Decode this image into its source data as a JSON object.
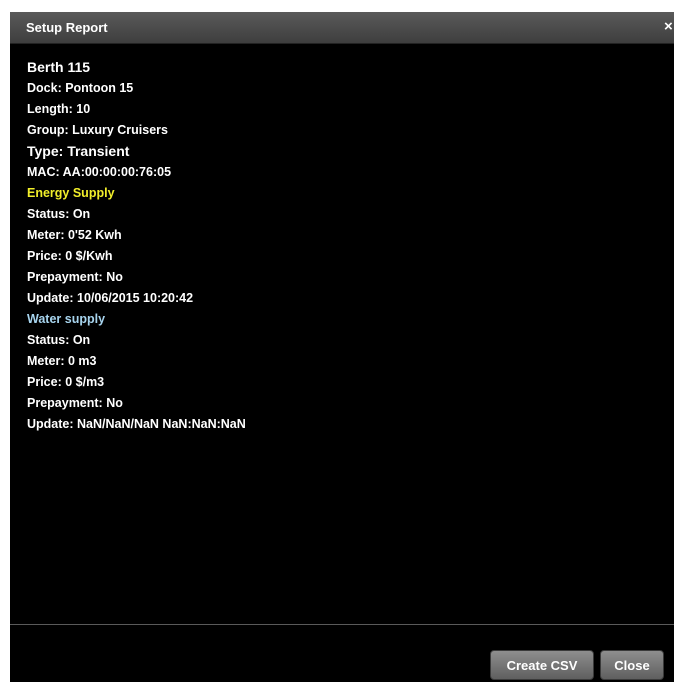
{
  "dialog": {
    "title": "Setup Report",
    "close_icon": "×"
  },
  "report": {
    "berth": "Berth 115",
    "dock": "Dock: Pontoon 15",
    "length": "Length: 10",
    "group": "Group: Luxury Cruisers",
    "type": "Type: Transient",
    "mac": "MAC: AA:00:00:00:76:05",
    "energy": {
      "heading": "Energy Supply",
      "status": "Status: On",
      "meter": "Meter: 0'52 Kwh",
      "price": "Price: 0 $/Kwh",
      "prepayment": "Prepayment: No",
      "update": "Update: 10/06/2015 10:20:42"
    },
    "water": {
      "heading": "Water supply",
      "status": "Status: On",
      "meter": "Meter: 0 m3",
      "price": "Price: 0 $/m3",
      "prepayment": "Prepayment: No",
      "update": "Update: NaN/NaN/NaN NaN:NaN:NaN"
    }
  },
  "footer": {
    "create_csv_label": "Create CSV",
    "close_label": "Close"
  },
  "colors": {
    "energy_heading": "#f2ef2a",
    "water_heading": "#a7d4ee",
    "background": "#000000"
  }
}
